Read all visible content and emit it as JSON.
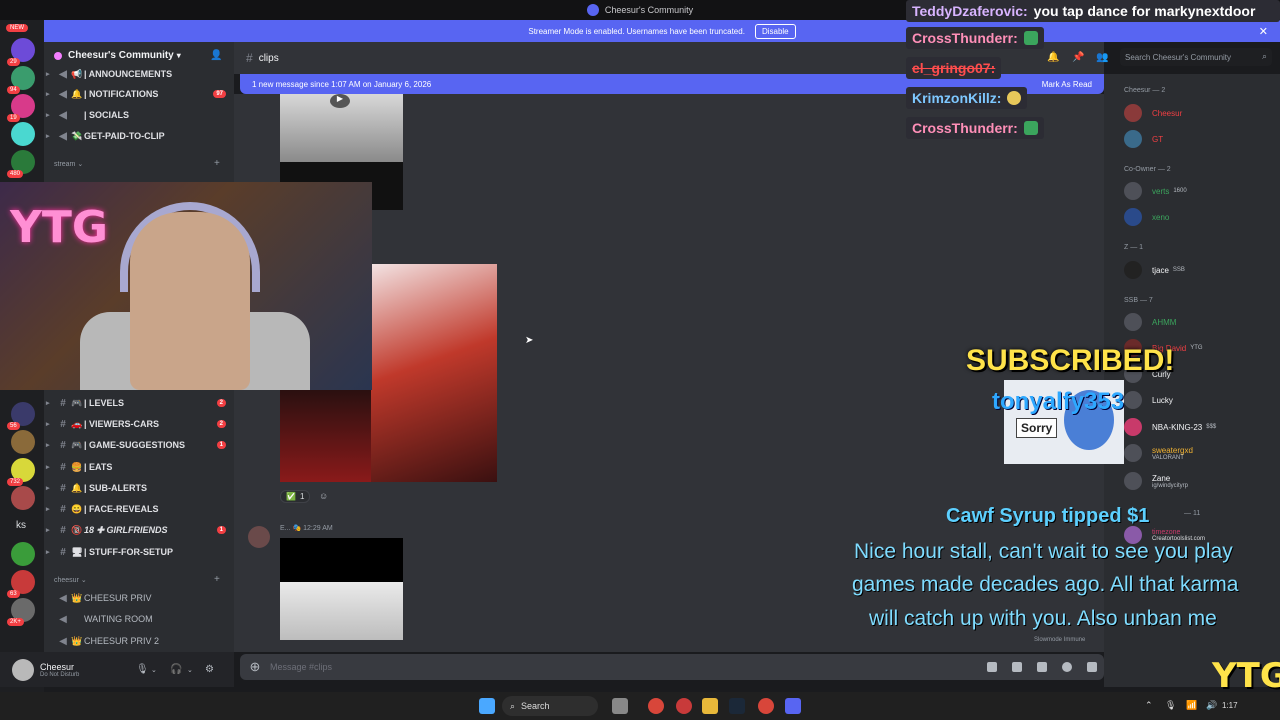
{
  "window": {
    "title": "Cheesur's Community"
  },
  "streamer_banner": {
    "text": "Streamer Mode is enabled. Usernames have been truncated.",
    "button": "Disable"
  },
  "server_rail": {
    "new_badge": "NEW",
    "badges": [
      "29",
      "94",
      "19",
      "480",
      "56",
      "732",
      "63",
      "2K+"
    ],
    "ks_label": "ks"
  },
  "guild": {
    "name": "Cheesur's Community"
  },
  "channels_top": [
    {
      "icon": "hash-icon",
      "emoji": "📢",
      "label": "| ANNOUNCEMENTS",
      "count": ""
    },
    {
      "icon": "speaker-icon",
      "emoji": "🔔",
      "label": "| NOTIFICATIONS",
      "count": "97"
    },
    {
      "icon": "speaker-icon",
      "emoji": "",
      "label": "| SOCIALS",
      "count": ""
    },
    {
      "icon": "speaker-icon",
      "emoji": "💸",
      "label": "GET-PAID-TO-CLIP",
      "count": ""
    }
  ],
  "category_stream": "stream",
  "channels_mid": [
    {
      "emoji": "🎮",
      "label": "| LEVELS",
      "count": "2"
    },
    {
      "emoji": "🚗",
      "label": "| VIEWERS-CARS",
      "count": "2"
    },
    {
      "emoji": "🎮",
      "label": "| GAME-SUGGESTIONS",
      "count": "1"
    },
    {
      "emoji": "🍔",
      "label": "| EATS",
      "count": ""
    },
    {
      "emoji": "🔔",
      "label": "| SUB-ALERTS",
      "count": ""
    },
    {
      "emoji": "😀",
      "label": "| FACE-REVEALS",
      "count": ""
    },
    {
      "emoji": "🔞",
      "label": "18 ✚ GIRLFRIENDS",
      "count": "1"
    },
    {
      "emoji": "🖥",
      "label": "| STUFF-FOR-SETUP",
      "count": ""
    }
  ],
  "category_cheesur": "cheesur",
  "voice_channels": [
    {
      "label": "CHEESUR PRIV"
    },
    {
      "label": "WAITING ROOM"
    },
    {
      "label": "CHEESUR PRIV 2"
    }
  ],
  "user": {
    "name": "Cheesur",
    "status": "Do Not Disturb"
  },
  "channel": {
    "name": "clips"
  },
  "new_message_bar": {
    "text": "1 new message since 1:07 AM on January 6, 2026",
    "action": "Mark As Read"
  },
  "messages": {
    "reaction_count": "1",
    "author2_time": "12:29 AM",
    "author2_name": "E..."
  },
  "composer": {
    "placeholder": "Message #clips"
  },
  "search": {
    "placeholder": "Search Cheesur's Community"
  },
  "members": {
    "groups": [
      {
        "label": "Cheesur — 2"
      },
      {
        "label": "Co-Owner — 2"
      },
      {
        "label": "Z — 1"
      },
      {
        "label": "SSB — 7"
      }
    ],
    "list": [
      {
        "name": "Cheesur",
        "color": "#f23f43",
        "tag": ""
      },
      {
        "name": "GT",
        "color": "#f23f43",
        "tag": ""
      },
      {
        "name": "verts",
        "color": "#3ba55d",
        "tag": "1600"
      },
      {
        "name": "xeno",
        "color": "#3ba55d",
        "tag": ""
      },
      {
        "name": "tjace",
        "color": "#f2f3f5",
        "tag": "SSB"
      },
      {
        "name": "AHMM",
        "color": "#3ba55d",
        "tag": ""
      },
      {
        "name": "Big David",
        "color": "#f23f43",
        "tag": "YTG"
      },
      {
        "name": "Curly",
        "color": "#f2f3f5",
        "tag": ""
      },
      {
        "name": "Lucky",
        "color": "#f2f3f5",
        "tag": ""
      },
      {
        "name": "NBA-KING-23",
        "color": "#f2f3f5",
        "tag": "$$$"
      },
      {
        "name": "sweatergxd",
        "color": "#f0b232",
        "tag": "VALORANT"
      },
      {
        "name": "Zane",
        "color": "#f2f3f5",
        "tag": "ig/windycityrp"
      }
    ],
    "more_label": "— 11",
    "timezone": "timezone",
    "site": "Creatortoolslist.com",
    "slowmode": "Slowmode Immune"
  },
  "stream_chat": [
    {
      "user": "TeddyDzaferovic:",
      "msg": "you tap dance for markynextdoor",
      "color": "#d8b4ff"
    },
    {
      "user": "CrossThunderr:",
      "msg": "",
      "color": "#ff8fb8"
    },
    {
      "user": "el_gringo07:",
      "msg": "",
      "color": "#ff4d4d"
    },
    {
      "user": "KrimzonKillz:",
      "msg": "",
      "color": "#7ec8ff"
    },
    {
      "user": "CrossThunderr:",
      "msg": "",
      "color": "#ff8fb8"
    }
  ],
  "sub_alert": {
    "title": "SUBSCRIBED!",
    "name": "tonyalfy353",
    "sticker_text": "Sorry"
  },
  "tip_alert": {
    "title": "Cawf Syrup tipped $1",
    "lines": [
      "Nice hour stall, can't wait to see you play",
      "games made decades ago. All that karma",
      "will catch up with you. Also unban me"
    ]
  },
  "webcam": {
    "overlay_text": "YTG"
  },
  "taskbar": {
    "search": "Search",
    "time": "1:17"
  },
  "colors": {
    "accent": "#5865f2",
    "sub_yellow": "#ffe34a",
    "tip_blue": "#7fdcff"
  }
}
